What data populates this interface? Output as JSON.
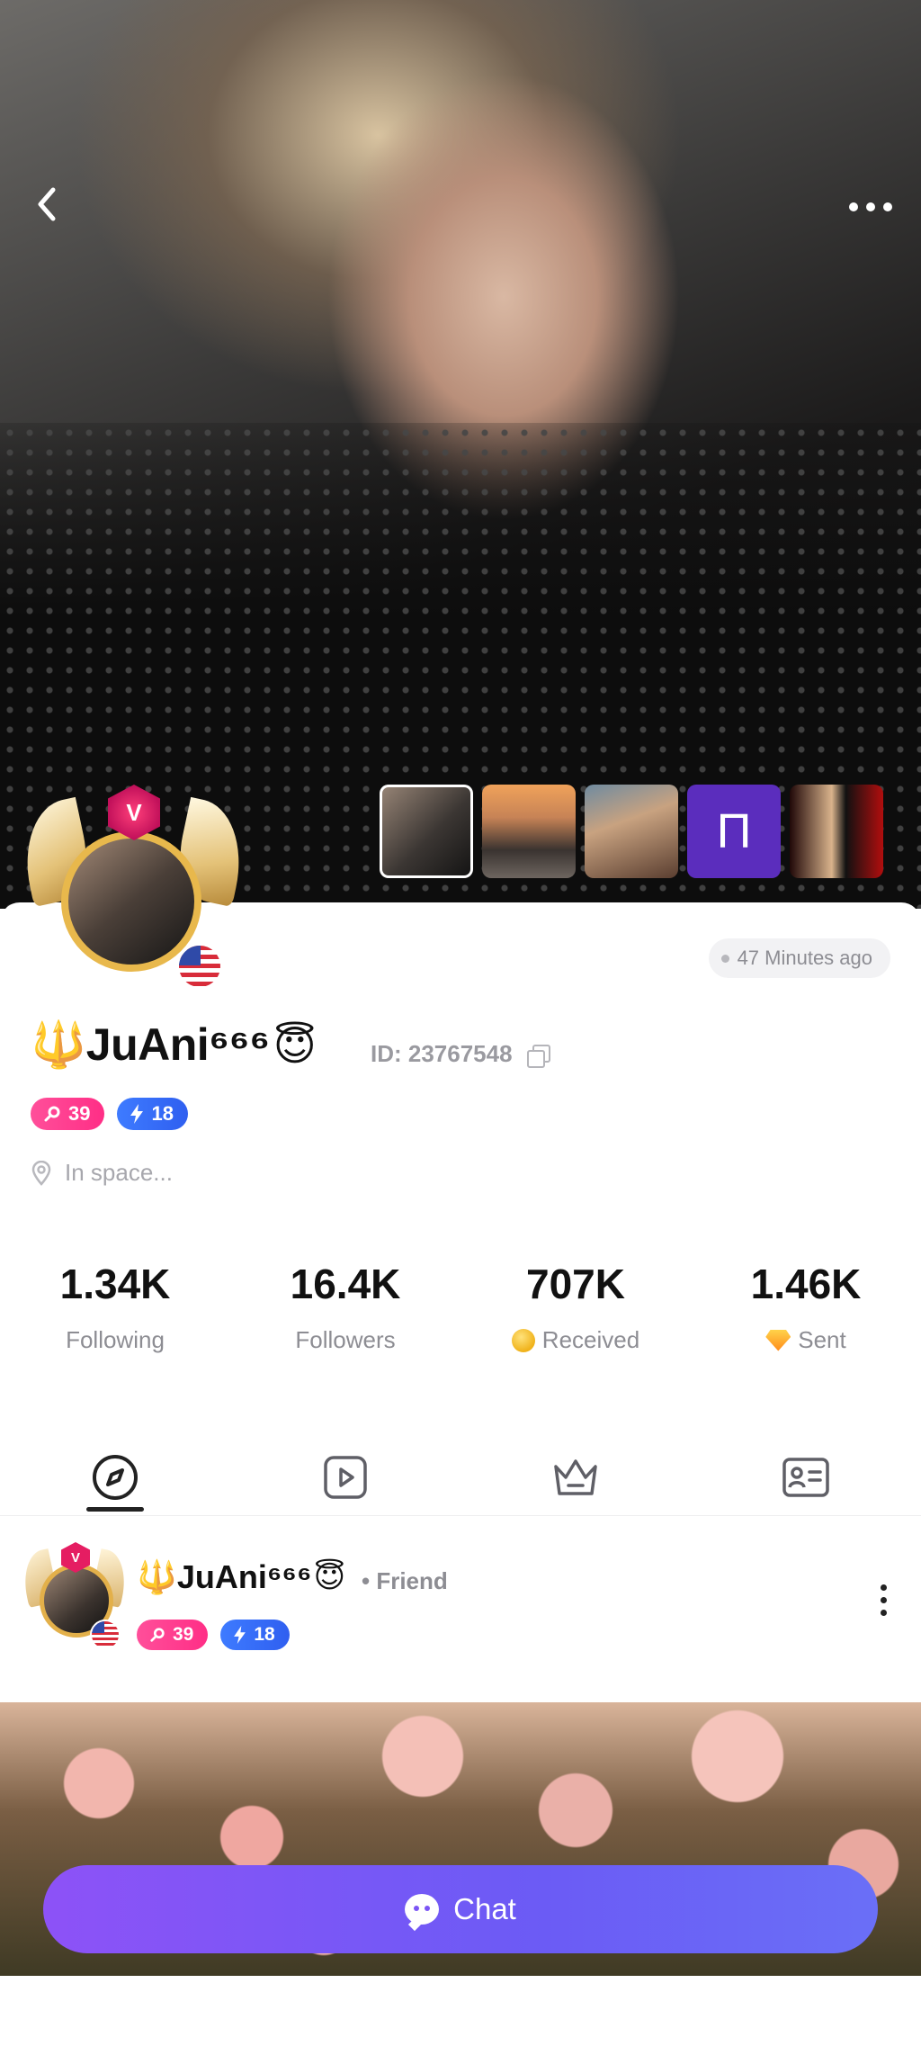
{
  "header": {
    "back_icon": "chevron-left-icon",
    "more_icon": "more-horizontal-icon"
  },
  "gallery": {
    "thumbnails": [
      "photo-1",
      "photo-2",
      "photo-3",
      "П",
      "photo-5"
    ]
  },
  "profile": {
    "vip_letter": "V",
    "last_seen": "47 Minutes ago",
    "name": "🔱JuAni⁶⁶⁶",
    "name_emoji": "😇",
    "id_label": "ID: 23767548",
    "level": "39",
    "charm": "18",
    "location": "In space..."
  },
  "stats": [
    {
      "value": "1.34K",
      "label": "Following"
    },
    {
      "value": "16.4K",
      "label": "Followers"
    },
    {
      "value": "707K",
      "label": "Received"
    },
    {
      "value": "1.46K",
      "label": "Sent"
    }
  ],
  "tabs": [
    "compass-icon",
    "play-icon",
    "crown-icon",
    "profile-card-icon"
  ],
  "post": {
    "vip_letter": "V",
    "author": "🔱JuAni⁶⁶⁶",
    "author_emoji": "😇",
    "relation": "• Friend",
    "level": "39",
    "charm": "18"
  },
  "chat_button": {
    "label": "Chat"
  },
  "colors": {
    "accent": "#7b55f5",
    "level_pill": "#ff3d8f",
    "charm_pill": "#3a6ff7"
  }
}
